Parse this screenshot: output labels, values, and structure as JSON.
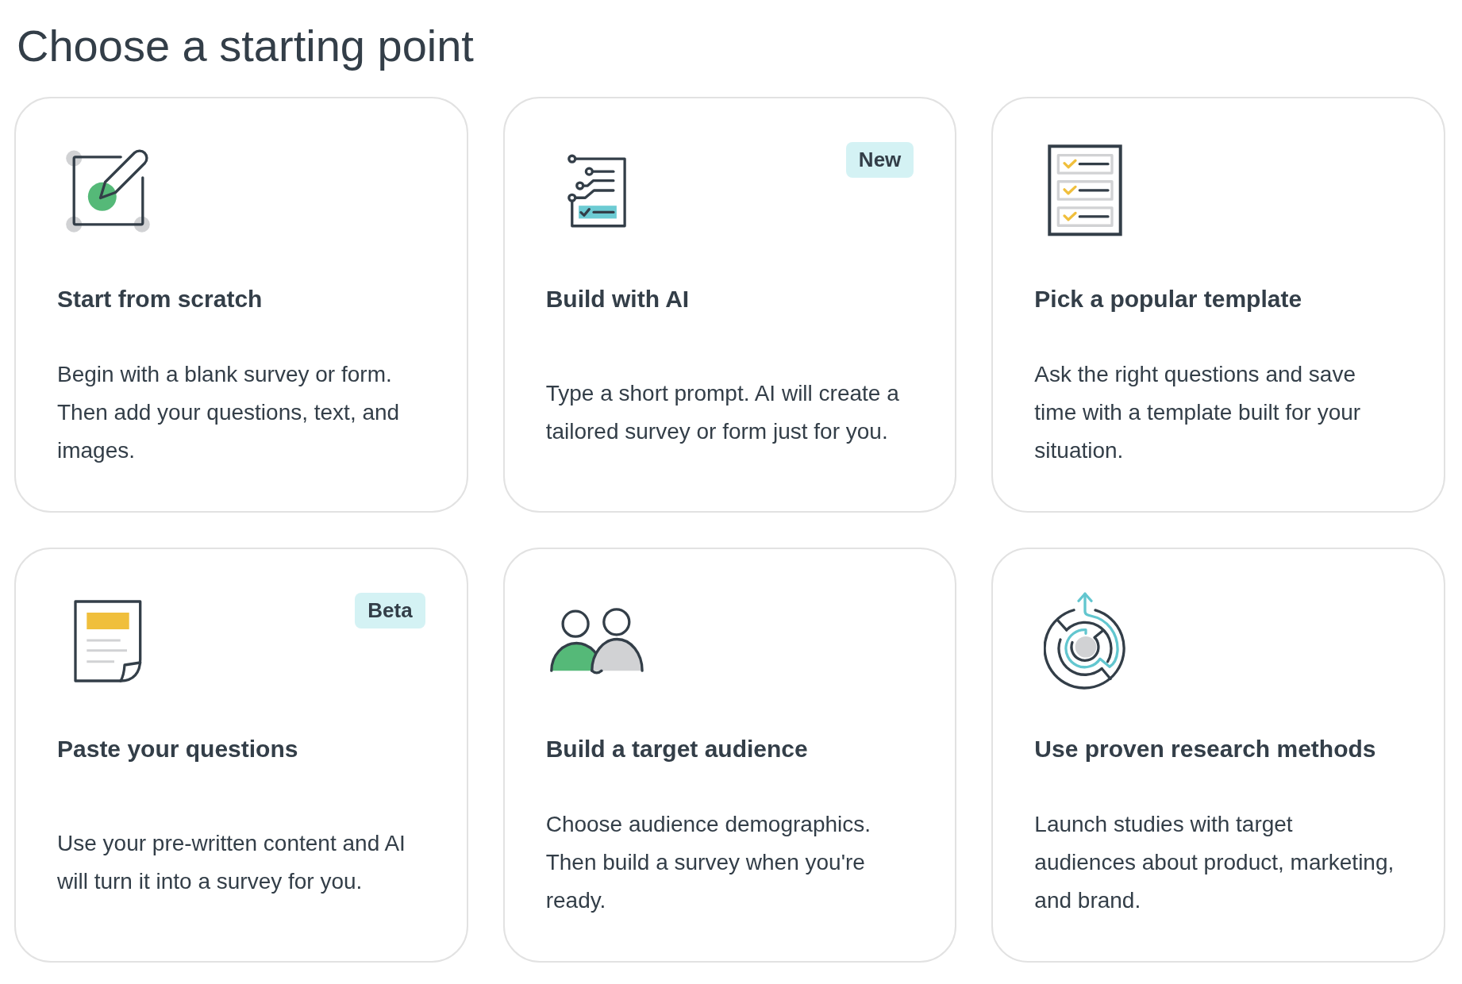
{
  "title": "Choose a starting point",
  "options": [
    {
      "kind": "scratch",
      "title": "Start from scratch",
      "description": "Begin with a blank survey or form. Then add your questions, text, and images."
    },
    {
      "kind": "ai",
      "title": "Build with AI",
      "badge": "New",
      "description": "Type a short prompt. AI will create a tailored survey or form just for you."
    },
    {
      "kind": "template",
      "title": "Pick a popular template",
      "description": "Ask the right questions and save time with a template built for your situation."
    },
    {
      "kind": "paste",
      "title": "Paste your questions",
      "badge": "Beta",
      "description": "Use your pre-written content and AI will turn it into a survey for you."
    },
    {
      "kind": "audience",
      "title": "Build a target audience",
      "description": "Choose audience demographics. Then build a survey when you're ready."
    },
    {
      "kind": "methods",
      "title": "Use proven research methods",
      "description": "Launch studies with target audiences about product, marketing, and brand."
    }
  ]
}
